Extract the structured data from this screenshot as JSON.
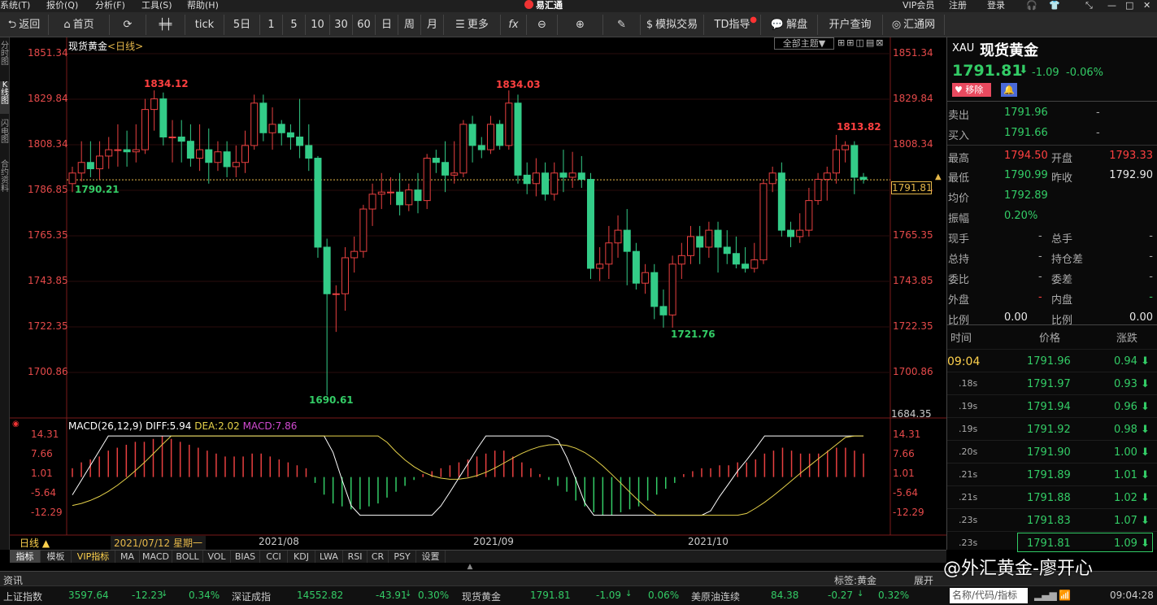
{
  "menu": {
    "system": "系统(T)",
    "quote": "报价(Q)",
    "analysis": "分析(F)",
    "tools": "工具(S)",
    "help": "帮助(H)",
    "app_title": "易汇通",
    "vip": "VIP会员",
    "register": "注册",
    "login": "登录"
  },
  "toolbar": {
    "back": "返回",
    "home": "首页",
    "tick": "tick",
    "d5": "5日",
    "n1": "1",
    "n5": "5",
    "n10": "10",
    "n30": "30",
    "n60": "60",
    "day": "日",
    "week": "周",
    "month": "月",
    "more": "更多",
    "fx": "fx",
    "simtrade": "模拟交易",
    "td": "TD指导",
    "jiepan": "解盘",
    "account": "开户查询",
    "huitong": "汇通网"
  },
  "left_tabs": [
    "分时图",
    "K线图",
    "闪电图",
    "合约资料"
  ],
  "chart": {
    "title": "现货黄金",
    "period": "<日线>",
    "theme_btn": "全部主题▼",
    "price_axis": [
      "1851.34",
      "1829.84",
      "1808.34",
      "1786.85",
      "1765.35",
      "1743.85",
      "1722.35",
      "1700.86"
    ],
    "last_price_tag": "1791.81",
    "bottom_tag": "1684.35",
    "annotations": {
      "hi1": "1834.12",
      "hi2": "1834.03",
      "hi3": "1813.82",
      "lo1": "1790.21",
      "lo2": "1690.61",
      "lo3": "1721.76"
    },
    "dates": [
      "2021/07/12 星期一",
      "2021/08",
      "2021/09",
      "2021/10"
    ],
    "period_label": "日线 ▲"
  },
  "macd": {
    "label": "MACD(26,12,9)",
    "diff": "DIFF:5.94",
    "dea": "DEA:2.02",
    "macdv": "MACD:7.86",
    "axis": [
      "14.31",
      "7.66",
      "1.01",
      "-5.64",
      "-12.29"
    ]
  },
  "bottom_tabs": [
    "指标",
    "模板",
    "VIP指标",
    "MA",
    "MACD",
    "BOLL",
    "VOL",
    "BIAS",
    "CCI",
    "KDJ",
    "LWA",
    "RSI",
    "CR",
    "PSY",
    "设置"
  ],
  "infobar": {
    "news": "资讯",
    "tag": "标签:黄金",
    "expand": "展开",
    "watermark": "@外汇黄金-廖开心"
  },
  "ticker": [
    {
      "name": "上证指数",
      "price": "3597.64",
      "chg": "-12.23",
      "pct": "0.34%"
    },
    {
      "name": "深证成指",
      "price": "14552.82",
      "chg": "-43.91",
      "pct": "0.30%"
    },
    {
      "name": "现货黄金",
      "price": "1791.81",
      "chg": "-1.09",
      "pct": "0.06%"
    },
    {
      "name": "美原油连续",
      "price": "84.38",
      "chg": "-0.27",
      "pct": "0.32%"
    }
  ],
  "ticker_search": "名称/代码/指标",
  "ticker_time": "09:04:28",
  "quote": {
    "code": "XAU",
    "name": "现货黄金",
    "price": "1791.81",
    "change": "-1.09",
    "pct": "-0.06%",
    "remove_btn": "移除",
    "sell_label": "卖出",
    "sell": "1791.96",
    "sell_dash": "-",
    "buy_label": "买入",
    "buy": "1791.66",
    "buy_dash": "-",
    "high_label": "最高",
    "high": "1794.50",
    "open_label": "开盘",
    "open": "1793.33",
    "low_label": "最低",
    "low": "1790.99",
    "prev_label": "昨收",
    "prev": "1792.90",
    "avg_label": "均价",
    "avg": "1792.89",
    "amp_label": "振幅",
    "amp": "0.20%",
    "cur_label": "现手",
    "cur": "-",
    "total_label": "总手",
    "total": "-",
    "hold_label": "总持",
    "hold": "-",
    "holddiff_label": "持仓差",
    "holddiff": "-",
    "wb_label": "委比",
    "wb": "-",
    "wc_label": "委差",
    "wc": "-",
    "out_label": "外盘",
    "out": "-",
    "in_label": "内盘",
    "in": "-",
    "ratio1_label": "比例",
    "ratio1": "0.00",
    "ratio2_label": "比例",
    "ratio2": "0.00"
  },
  "trades_header": {
    "time": "时间",
    "price": "价格",
    "change": "涨跌"
  },
  "trades": [
    {
      "time": "09:04",
      "price": "1791.96",
      "chg": "0.94"
    },
    {
      "time": ".18s",
      "price": "1791.97",
      "chg": "0.93"
    },
    {
      "time": ".19s",
      "price": "1791.94",
      "chg": "0.96"
    },
    {
      "time": ".19s",
      "price": "1791.92",
      "chg": "0.98"
    },
    {
      "time": ".20s",
      "price": "1791.90",
      "chg": "1.00"
    },
    {
      "time": ".21s",
      "price": "1791.89",
      "chg": "1.01"
    },
    {
      "time": ".21s",
      "price": "1791.88",
      "chg": "1.02"
    },
    {
      "time": ".23s",
      "price": "1791.83",
      "chg": "1.07"
    },
    {
      "time": ".23s",
      "price": "1791.81",
      "chg": "1.09"
    }
  ],
  "candles": [
    [
      1790,
      1795,
      1786,
      1798
    ],
    [
      1795,
      1800,
      1791,
      1810
    ],
    [
      1800,
      1797,
      1793,
      1810
    ],
    [
      1797,
      1803,
      1792,
      1810
    ],
    [
      1803,
      1806,
      1797,
      1812
    ],
    [
      1806,
      1806,
      1798,
      1818
    ],
    [
      1806,
      1805,
      1798,
      1815
    ],
    [
      1805,
      1806,
      1800,
      1818
    ],
    [
      1806,
      1825,
      1804,
      1830
    ],
    [
      1825,
      1830,
      1815,
      1834
    ],
    [
      1830,
      1812,
      1808,
      1833
    ],
    [
      1812,
      1812,
      1800,
      1820
    ],
    [
      1812,
      1810,
      1800,
      1820
    ],
    [
      1810,
      1802,
      1798,
      1818
    ],
    [
      1802,
      1806,
      1796,
      1818
    ],
    [
      1806,
      1800,
      1790,
      1816
    ],
    [
      1800,
      1805,
      1796,
      1810
    ],
    [
      1805,
      1798,
      1793,
      1810
    ],
    [
      1798,
      1800,
      1793,
      1808
    ],
    [
      1800,
      1808,
      1795,
      1815
    ],
    [
      1808,
      1828,
      1806,
      1832
    ],
    [
      1828,
      1814,
      1810,
      1832
    ],
    [
      1814,
      1818,
      1806,
      1826
    ],
    [
      1818,
      1814,
      1808,
      1820
    ],
    [
      1814,
      1812,
      1806,
      1818
    ],
    [
      1812,
      1808,
      1802,
      1830
    ],
    [
      1808,
      1802,
      1796,
      1818
    ],
    [
      1802,
      1760,
      1755,
      1803
    ],
    [
      1760,
      1738,
      1690,
      1764
    ],
    [
      1738,
      1738,
      1720,
      1742
    ],
    [
      1738,
      1755,
      1730,
      1760
    ],
    [
      1755,
      1758,
      1748,
      1765
    ],
    [
      1758,
      1778,
      1755,
      1780
    ],
    [
      1778,
      1785,
      1770,
      1790
    ],
    [
      1785,
      1786,
      1778,
      1795
    ],
    [
      1786,
      1786,
      1780,
      1793
    ],
    [
      1786,
      1780,
      1775,
      1795
    ],
    [
      1780,
      1787,
      1777,
      1790
    ],
    [
      1787,
      1782,
      1776,
      1795
    ],
    [
      1782,
      1802,
      1778,
      1804
    ],
    [
      1802,
      1800,
      1795,
      1806
    ],
    [
      1800,
      1794,
      1786,
      1810
    ],
    [
      1794,
      1795,
      1790,
      1810
    ],
    [
      1795,
      1818,
      1793,
      1820
    ],
    [
      1818,
      1808,
      1800,
      1822
    ],
    [
      1808,
      1806,
      1802,
      1812
    ],
    [
      1806,
      1818,
      1804,
      1822
    ],
    [
      1818,
      1808,
      1806,
      1820
    ],
    [
      1808,
      1828,
      1806,
      1834
    ],
    [
      1828,
      1794,
      1790,
      1832
    ],
    [
      1794,
      1790,
      1785,
      1800
    ],
    [
      1790,
      1795,
      1784,
      1802
    ],
    [
      1795,
      1785,
      1782,
      1800
    ],
    [
      1785,
      1795,
      1782,
      1800
    ],
    [
      1795,
      1793,
      1786,
      1806
    ],
    [
      1793,
      1795,
      1788,
      1805
    ],
    [
      1795,
      1792,
      1788,
      1803
    ],
    [
      1792,
      1750,
      1745,
      1795
    ],
    [
      1750,
      1752,
      1744,
      1760
    ],
    [
      1752,
      1762,
      1745,
      1770
    ],
    [
      1762,
      1768,
      1755,
      1775
    ],
    [
      1768,
      1758,
      1742,
      1778
    ],
    [
      1758,
      1743,
      1740,
      1762
    ],
    [
      1743,
      1748,
      1738,
      1752
    ],
    [
      1748,
      1732,
      1726,
      1752
    ],
    [
      1732,
      1728,
      1722,
      1740
    ],
    [
      1728,
      1752,
      1722,
      1756
    ],
    [
      1752,
      1756,
      1745,
      1762
    ],
    [
      1756,
      1765,
      1752,
      1770
    ],
    [
      1765,
      1760,
      1752,
      1770
    ],
    [
      1760,
      1768,
      1755,
      1772
    ],
    [
      1768,
      1760,
      1748,
      1772
    ],
    [
      1760,
      1757,
      1752,
      1768
    ],
    [
      1757,
      1752,
      1750,
      1765
    ],
    [
      1752,
      1750,
      1748,
      1760
    ],
    [
      1750,
      1754,
      1748,
      1762
    ],
    [
      1754,
      1790,
      1752,
      1792
    ],
    [
      1790,
      1795,
      1786,
      1798
    ],
    [
      1795,
      1768,
      1765,
      1800
    ],
    [
      1768,
      1765,
      1760,
      1772
    ],
    [
      1765,
      1768,
      1762,
      1776
    ],
    [
      1768,
      1782,
      1765,
      1788
    ],
    [
      1782,
      1792,
      1780,
      1795
    ],
    [
      1792,
      1795,
      1782,
      1798
    ],
    [
      1795,
      1806,
      1790,
      1813
    ],
    [
      1806,
      1808,
      1800,
      1810
    ],
    [
      1808,
      1793,
      1785,
      1810
    ],
    [
      1793,
      1792,
      1790,
      1795
    ]
  ],
  "macd_hist": [
    3,
    5,
    6,
    7,
    9,
    10,
    11,
    12,
    12,
    13,
    14,
    13,
    12,
    11,
    10,
    9,
    8,
    7,
    7,
    7,
    8,
    8,
    7,
    6,
    5,
    4,
    3,
    -2,
    -6,
    -9,
    -10,
    -11,
    -11,
    -10,
    -9,
    -7,
    -5,
    -3,
    -1,
    1,
    2,
    3,
    4,
    5,
    6,
    7,
    8,
    9,
    9,
    7,
    5,
    3,
    1,
    -1,
    -3,
    -5,
    -8,
    -10,
    -12,
    -13,
    -13,
    -12,
    -11,
    -10,
    -8,
    -6,
    -4,
    -2,
    1,
    2,
    3,
    3,
    4,
    4,
    5,
    5,
    6,
    8,
    9,
    10,
    9,
    8,
    8,
    8,
    9,
    10,
    10,
    9,
    8
  ]
}
